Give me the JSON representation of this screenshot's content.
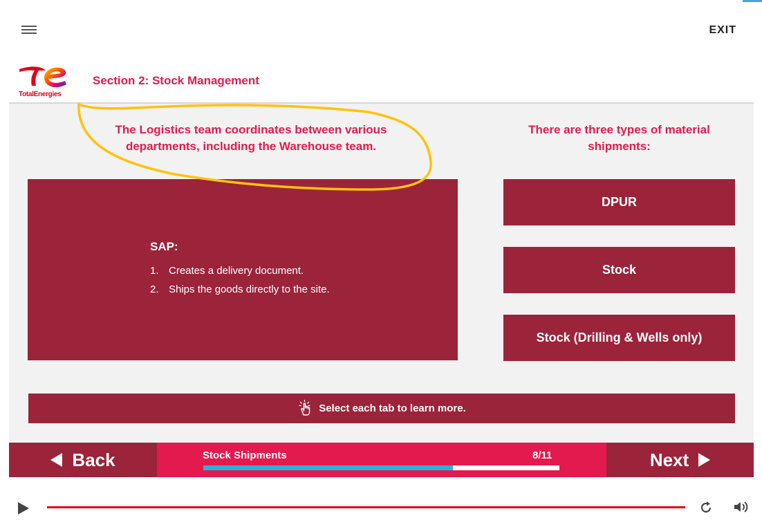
{
  "topbar": {
    "exit_label": "EXIT"
  },
  "header": {
    "brand": "TotalEnergies",
    "section_title": "Section 2: Stock Management"
  },
  "main": {
    "intro_left": "The Logistics team coordinates between various departments, including the Warehouse team.",
    "intro_right": "There are three types of material shipments:",
    "content": {
      "heading": "SAP:",
      "items": [
        {
          "num": "1.",
          "text": "Creates a delivery document."
        },
        {
          "num": "2.",
          "text": "Ships the goods directly to the site."
        }
      ]
    },
    "tabs": [
      {
        "label": "DPUR"
      },
      {
        "label": "Stock"
      },
      {
        "label": "Stock (Drilling & Wells only)"
      }
    ],
    "instruction": "Select each tab to learn more."
  },
  "nav": {
    "back_label": "Back",
    "next_label": "Next",
    "progress_title": "Stock Shipments",
    "progress_count": "8/11",
    "progress_fraction": 0.7
  },
  "colors": {
    "maroon": "#9b233a",
    "accent_red": "#e21a4d",
    "progress_blue": "#2bb2dc",
    "annotation_yellow": "#ffc20e"
  },
  "icons": {
    "menu": "hamburger-icon",
    "hand": "hand-pointer-icon",
    "back": "triangle-left-icon",
    "next": "triangle-right-icon",
    "play": "play-icon",
    "replay": "replay-icon",
    "volume": "volume-icon"
  }
}
